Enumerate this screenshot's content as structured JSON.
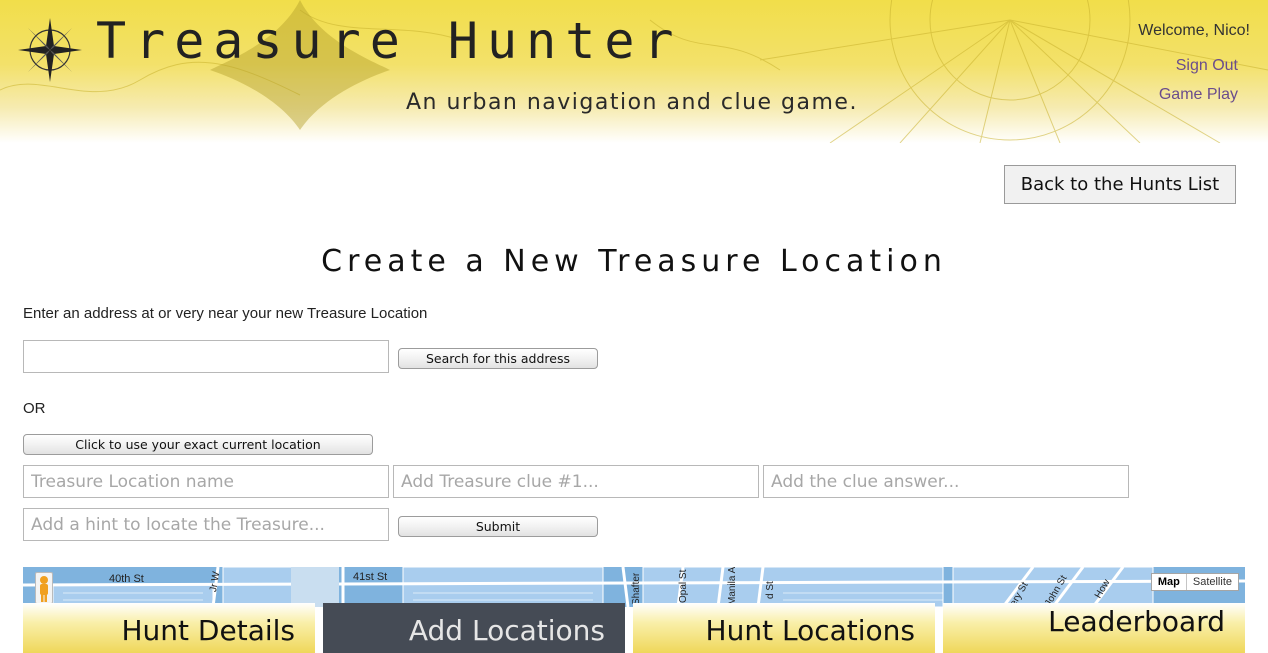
{
  "header": {
    "site_title": "Treasure Hunter",
    "tagline": "An urban navigation and clue game.",
    "welcome": "Welcome, Nico!",
    "sign_out": "Sign Out",
    "game_play": "Game Play"
  },
  "back_button": "Back to the Hunts List",
  "page_heading": "Create a New Treasure Location",
  "form": {
    "instruction": "Enter an address at or very near your new Treasure Location",
    "address_value": "",
    "search_button": "Search for this address",
    "or_text": "OR",
    "current_location_button": "Click to use your exact current location",
    "name_placeholder": "Treasure Location name",
    "clue_placeholder": "Add Treasure clue #1...",
    "answer_placeholder": "Add the clue answer...",
    "hint_placeholder": "Add a hint to locate the Treasure...",
    "submit_button": "Submit"
  },
  "map": {
    "type_map": "Map",
    "type_satellite": "Satellite",
    "street_labels": [
      "40th St",
      "Jr W",
      "41st St",
      "Shafter",
      "Opal St",
      "Manila A",
      "d St",
      "ery St",
      "John St",
      "How"
    ]
  },
  "nav": {
    "tabs": [
      "Hunt Details",
      "Add Locations",
      "Hunt Locations",
      "Leaderboard"
    ],
    "active_index": 1
  },
  "colors": {
    "header_yellow": "#f1de4a",
    "link_purple": "#6a4d8c",
    "nav_active": "#454b55",
    "map_water_blue": "#7fb3de"
  }
}
